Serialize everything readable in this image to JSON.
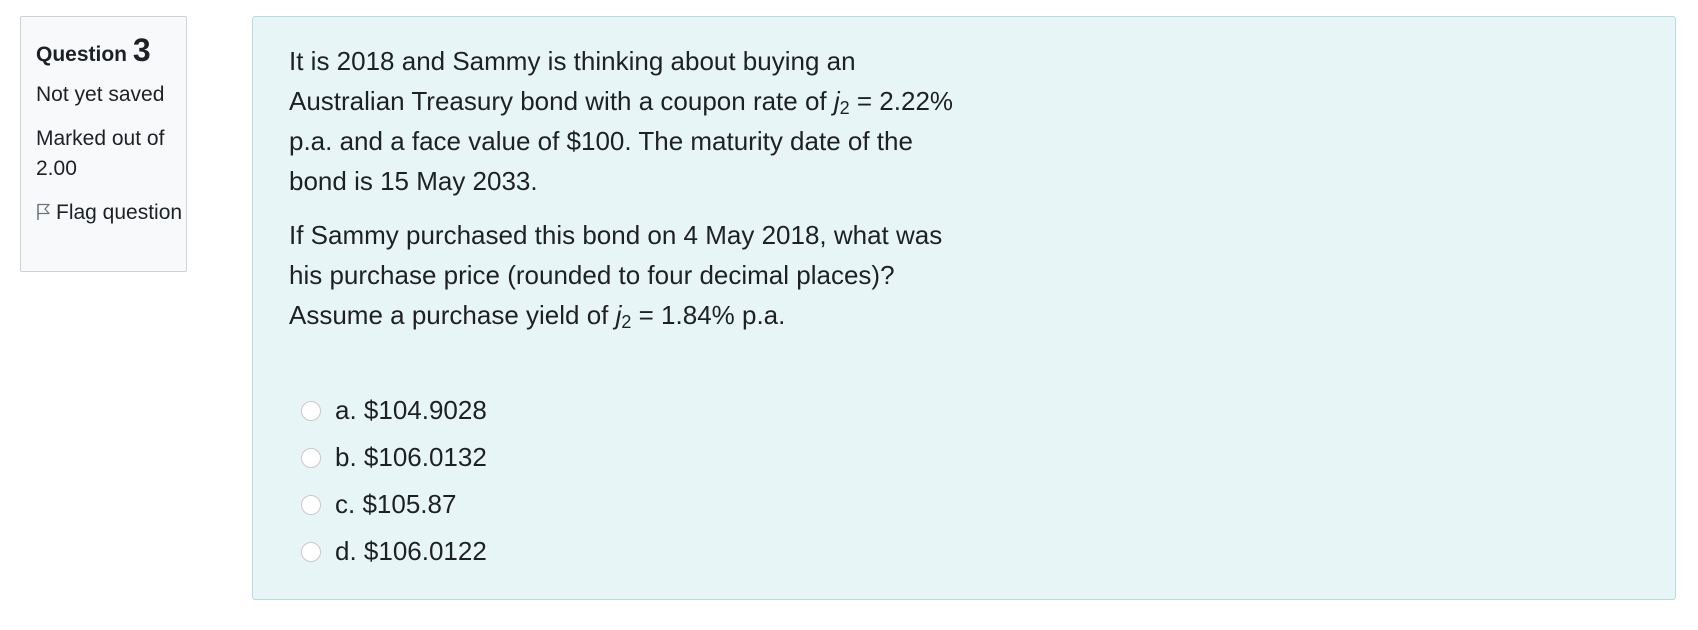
{
  "question_info": {
    "label": "Question",
    "number": "3",
    "state": "Not yet saved",
    "grade": "Marked out of 2.00",
    "flag_label": "Flag question"
  },
  "question": {
    "p1_a": "It is 2018 and Sammy is thinking about buying an Australian Treasury bond with a coupon rate of ",
    "p1_var": "j",
    "p1_sub": "2",
    "p1_b": " = 2.22%  p.a. and a face value of $100. The maturity date of the bond is 15 May 2033.",
    "p2_a": "If Sammy purchased this bond on 4 May 2018,  what was his purchase price (rounded to four decimal places)? Assume a purchase yield of ",
    "p2_var": "j",
    "p2_sub": "2",
    "p2_b": " = 1.84% p.a."
  },
  "answers": [
    {
      "label": "a. $104.9028",
      "selected": false
    },
    {
      "label": "b. $106.0132",
      "selected": false
    },
    {
      "label": "c. $105.87",
      "selected": false
    },
    {
      "label": "d. $106.0122",
      "selected": false
    }
  ],
  "colors": {
    "content_bg": "#e8f5f7",
    "content_border": "#b8dce2",
    "info_bg": "#f8f9fa",
    "info_border": "#cfd3d7"
  },
  "icons": {
    "flag": "flag-icon",
    "radio": "radio-button"
  }
}
